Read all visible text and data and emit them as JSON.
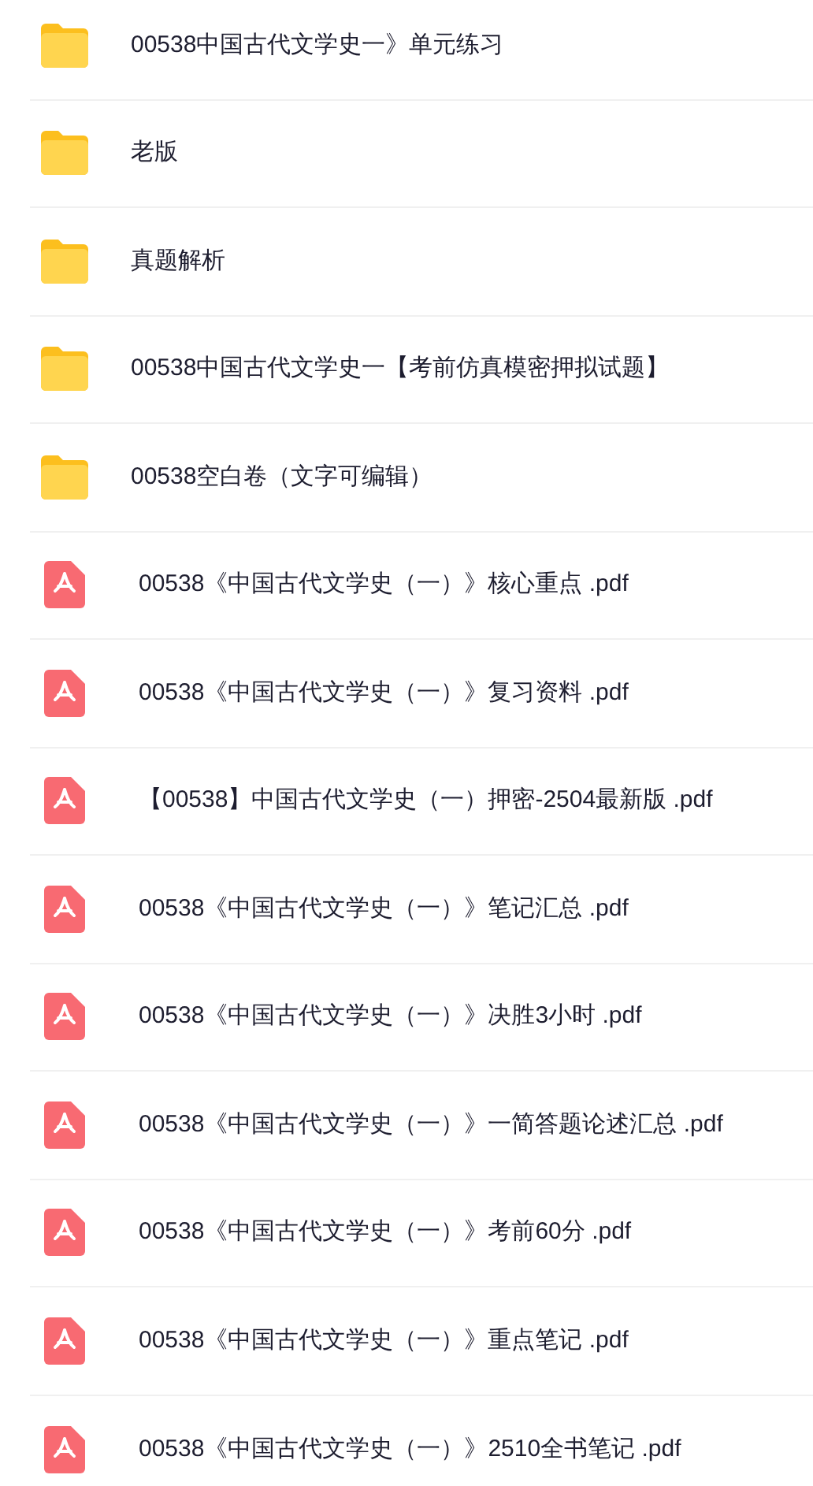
{
  "files": [
    {
      "kind": "folder",
      "name": "00538中国古代文学史一》单元练习"
    },
    {
      "kind": "folder",
      "name": "老版"
    },
    {
      "kind": "folder",
      "name": "真题解析"
    },
    {
      "kind": "folder",
      "name": "00538中国古代文学史一【考前仿真模密押拟试题】"
    },
    {
      "kind": "folder",
      "name": "00538空白卷（文字可编辑）"
    },
    {
      "kind": "pdf",
      "name": "00538《中国古代文学史（一）》核心重点 .pdf"
    },
    {
      "kind": "pdf",
      "name": "00538《中国古代文学史（一）》复习资料 .pdf"
    },
    {
      "kind": "pdf",
      "name": "【00538】中国古代文学史（一）押密-2504最新版 .pdf"
    },
    {
      "kind": "pdf",
      "name": "00538《中国古代文学史（一）》笔记汇总 .pdf"
    },
    {
      "kind": "pdf",
      "name": "00538《中国古代文学史（一）》决胜3小时 .pdf"
    },
    {
      "kind": "pdf",
      "name": "00538《中国古代文学史（一）》一简答题论述汇总 .pdf"
    },
    {
      "kind": "pdf",
      "name": "00538《中国古代文学史（一）》考前60分 .pdf"
    },
    {
      "kind": "pdf",
      "name": "00538《中国古代文学史（一）》重点笔记 .pdf"
    },
    {
      "kind": "pdf",
      "name": "00538《中国古代文学史（一）》2510全书笔记 .pdf"
    }
  ]
}
